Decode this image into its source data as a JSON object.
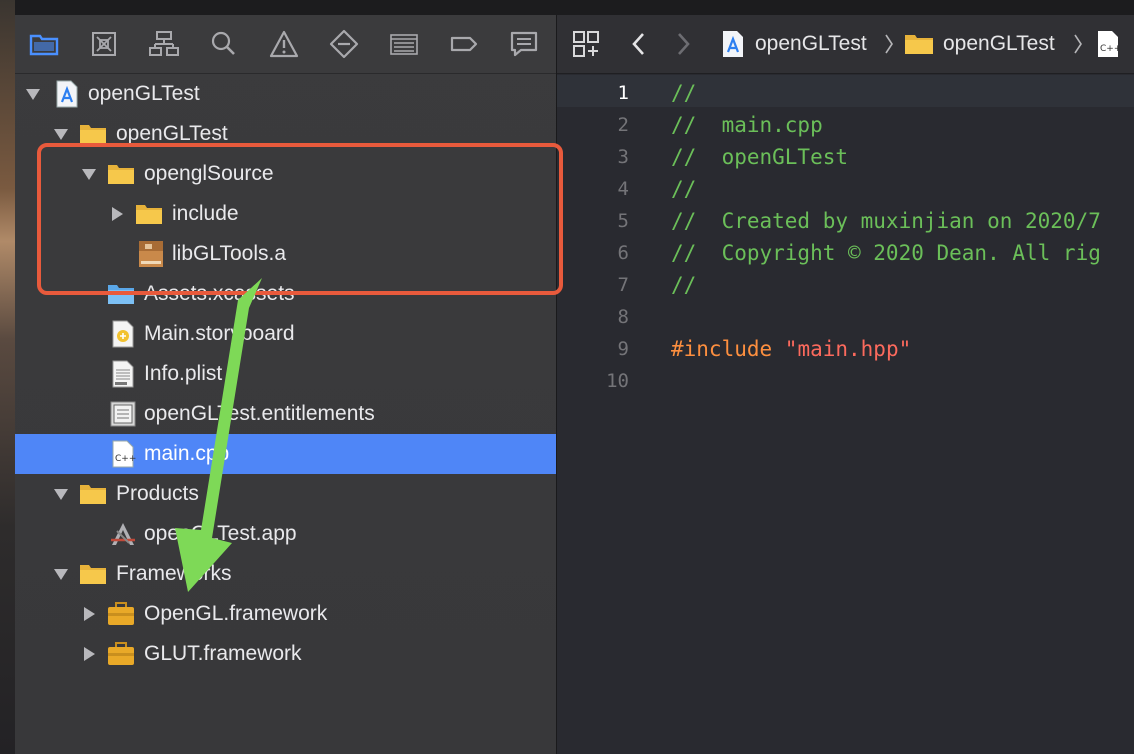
{
  "navigator": {
    "toolbar_icons": [
      "folder-icon",
      "source-control-icon",
      "hierarchy-icon",
      "search-icon",
      "warning-icon",
      "test-icon",
      "debug-icon",
      "breakpoint-icon",
      "report-icon"
    ],
    "tree": [
      {
        "label": "openGLTest",
        "icon": "xcode-project-icon",
        "disclosure": "expanded",
        "depth": 0
      },
      {
        "label": "openGLTest",
        "icon": "folder-icon",
        "disclosure": "expanded",
        "depth": 1
      },
      {
        "label": "openglSource",
        "icon": "folder-icon",
        "disclosure": "expanded",
        "depth": 2
      },
      {
        "label": "include",
        "icon": "folder-icon",
        "disclosure": "collapsed",
        "depth": 3
      },
      {
        "label": "libGLTools.a",
        "icon": "archive-icon",
        "disclosure": "none",
        "depth": 3
      },
      {
        "label": "Assets.xcassets",
        "icon": "asset-catalog-icon",
        "disclosure": "none",
        "depth": 2
      },
      {
        "label": "Main.storyboard",
        "icon": "storyboard-icon",
        "disclosure": "none",
        "depth": 2
      },
      {
        "label": "Info.plist",
        "icon": "plist-icon",
        "disclosure": "none",
        "depth": 2
      },
      {
        "label": "openGLTest.entitlements",
        "icon": "entitlements-icon",
        "disclosure": "none",
        "depth": 2
      },
      {
        "label": "main.cpp",
        "icon": "cpp-file-icon",
        "disclosure": "none",
        "depth": 2,
        "selected": true
      },
      {
        "label": "Products",
        "icon": "folder-icon",
        "disclosure": "expanded",
        "depth": 1
      },
      {
        "label": "openGLTest.app",
        "icon": "app-icon",
        "disclosure": "none",
        "depth": 2
      },
      {
        "label": "Frameworks",
        "icon": "folder-icon",
        "disclosure": "expanded",
        "depth": 1
      },
      {
        "label": "OpenGL.framework",
        "icon": "framework-icon",
        "disclosure": "collapsed",
        "depth": 2
      },
      {
        "label": "GLUT.framework",
        "icon": "framework-icon",
        "disclosure": "collapsed",
        "depth": 2
      }
    ]
  },
  "editor": {
    "breadcrumb": [
      "openGLTest",
      "openGLTest"
    ],
    "current_line": 1,
    "lines": [
      {
        "n": "1",
        "text": "//",
        "kind": "comment"
      },
      {
        "n": "2",
        "text": "//  main.cpp",
        "kind": "comment"
      },
      {
        "n": "3",
        "text": "//  openGLTest",
        "kind": "comment"
      },
      {
        "n": "4",
        "text": "//",
        "kind": "comment"
      },
      {
        "n": "5",
        "text": "//  Created by muxinjian on 2020/7",
        "kind": "comment"
      },
      {
        "n": "6",
        "text": "//  Copyright © 2020 Dean. All rig",
        "kind": "comment"
      },
      {
        "n": "7",
        "text": "//",
        "kind": "comment"
      },
      {
        "n": "8",
        "text": "",
        "kind": "plain"
      },
      {
        "n": "9",
        "pp": "#include ",
        "str": "\"main.hpp\"",
        "kind": "include"
      },
      {
        "n": "10",
        "text": "",
        "kind": "plain"
      }
    ]
  },
  "colors": {
    "selection": "#4f86f7",
    "comment": "#6bbf59",
    "preprocessor": "#fd8f3f",
    "string": "#fc6a5d",
    "highlight_box": "#e85a3c",
    "arrow": "#7ed957"
  }
}
